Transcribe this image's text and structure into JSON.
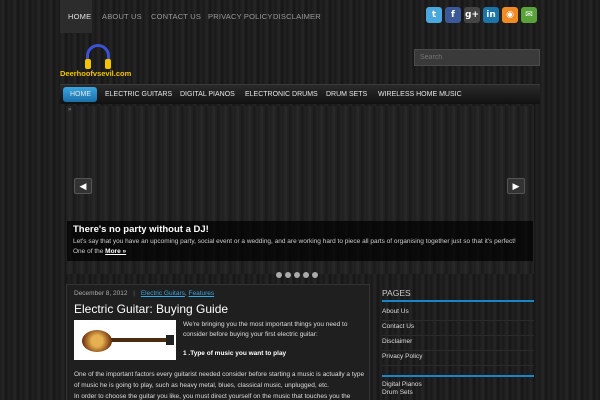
{
  "topnav": {
    "items": [
      "HOME",
      "ABOUT US",
      "CONTACT US",
      "PRIVACY POLICY",
      "DISCLAIMER"
    ]
  },
  "social": [
    {
      "name": "twitter-icon",
      "glyph": "t",
      "color": "#4aa8de"
    },
    {
      "name": "facebook-icon",
      "glyph": "f",
      "color": "#3b5998"
    },
    {
      "name": "google-plus-icon",
      "glyph": "g+",
      "color": "#444444"
    },
    {
      "name": "linkedin-icon",
      "glyph": "in",
      "color": "#1d74a8"
    },
    {
      "name": "rss-icon",
      "glyph": "◉",
      "color": "#f08a24"
    },
    {
      "name": "email-icon",
      "glyph": "✉",
      "color": "#5aa33a"
    }
  ],
  "logo": {
    "text": "Deerhoofvsevil.com"
  },
  "search": {
    "placeholder": "Search"
  },
  "mainnav": {
    "items": [
      "HOME",
      "ELECTRIC GUITARS",
      "DIGITAL PIANOS",
      "ELECTRONIC DRUMS",
      "DRUM SETS",
      "WIRELESS HOME MUSIC"
    ]
  },
  "slider": {
    "marker": "»",
    "prev": "◀",
    "next": "▶",
    "title": "There's no party without a DJ!",
    "text": "Let's say that you have an upcoming party, social event or a wedding, and are working hard to piece all parts of organising together just so that it's perfect! One of the",
    "more": "More »"
  },
  "post": {
    "date": "December 8, 2012",
    "sep": "|",
    "categories": [
      "Electric Guitars",
      "Features"
    ],
    "title": "Electric Guitar: Buying Guide",
    "intro": "We're bringing you the most important things you need to consider before buying your first electric guitar:",
    "subheading": "1 .Type of music you want to play",
    "body1": "One of the important factors every guitarist needed consider before starting a music is actually a type of music he is going to play, such as heavy metal, blues, classical music, unplugged, etc.",
    "body2": "In order to choose the guitar you like, you must direct yourself on the music that touches you the"
  },
  "sidebar": {
    "pages_title": "PAGES",
    "pages": [
      "About Us",
      "Contact Us",
      "Disclaimer",
      "Privacy Policy"
    ],
    "cats": [
      "Digital Pianos",
      "Drum Sets"
    ]
  }
}
